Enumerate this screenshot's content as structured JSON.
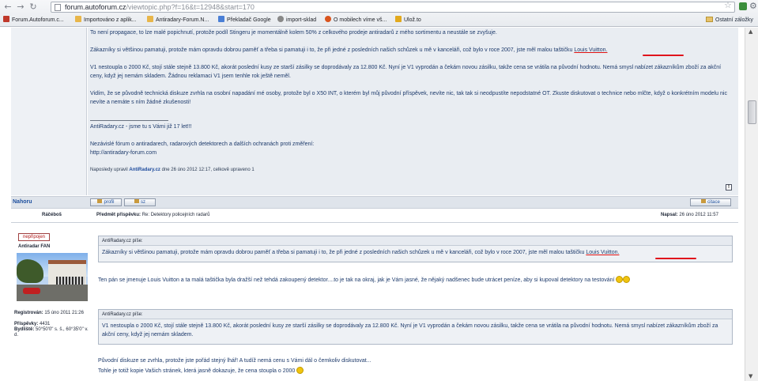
{
  "browser": {
    "url_host": "forum.autoforum.cz",
    "url_path": "/viewtopic.php?f=16&t=12948&start=170",
    "bookmarks": [
      {
        "label": "Forum.Autoforum.c...",
        "color": "#c0392b"
      },
      {
        "label": "Importováno z aplik...",
        "color": "#e8b64a"
      },
      {
        "label": "Antiradary-Forum.N...",
        "color": "#e8b64a"
      },
      {
        "label": "Překladač Google",
        "color": "#4a7fd6"
      },
      {
        "label": "import-sklad",
        "color": "#888888"
      },
      {
        "label": "O mobilech víme vš...",
        "color": "#d9541e"
      },
      {
        "label": "Ulož.to",
        "color": "#e2a91d"
      }
    ],
    "other_bookmarks": "Ostatní záložky"
  },
  "post1": {
    "para1": "To není propagace, to lze malé popichnutí, protože podíl Stingeru je momentálně kolem 50% z celkového prodeje antiradarů z mého sortimentu a neustále se zvyšuje.",
    "para2_a": "Zákazníky si většinou pamatuji, protože mám opravdu dobrou paměť a třeba si pamatuji i to, že při jedné z posledních našich schůzek u mě v kanceláři, což bylo v roce 2007, jste měl malou taštičku ",
    "para2_link": "Louis Vuitton.",
    "para3": "V1 nestoupla o 2000 Kč, stojí stále stejně 13.800 Kč, akorát poslední kusy ze starší zásilky se doprodávaly za 12.800 Kč. Nyní je V1 vyprodán a čekám novou zásilku, takže cena se vrátila na původní hodnotu. Nemá smysl nabízet zákazníkům zboží za akční ceny, když jej nemám skladem. Žádnou reklamaci V1 jsem tenhle rok ještě neměl.",
    "para4": "Vidím, že se původně technická diskuze zvrhla na osobní napadání mé osoby, protože byl o X50 INT, o kterém byl můj původní příspěvek, nevíte nic, tak tak si neodpustíte nepodstatné OT. Zkuste diskutovat o technice nebo mlčte, když o konkrétním modelu nic nevíte a nemáte s ním žádné zkušenosti!",
    "signature": "AntiRadary.cz - jsme tu s Vámi již 17 let!!!",
    "sig_line2": "Nezávislé fórum o antiradarech, radarových detektorech a dalších ochranách proti změření:",
    "sig_line3": "http://antiradary-forum.com",
    "edited_prefix": "Naposledy upravil ",
    "edited_user": "AntiRadary.cz",
    "edited_suffix": " dne 26 úno 2012 12:17, celkově upraveno 1"
  },
  "actionbar": {
    "top_link": "Nahoru",
    "profile_btn": "profil",
    "pm_btn": "sz",
    "quote_btn": "citace"
  },
  "post2": {
    "author": "Ráčéboš",
    "subject_label": "Předmět příspěvku:",
    "subject": " Re: Detektory policejních radarů",
    "posted_label": "Napsal:",
    "posted": " 26 úno 2012 11:57",
    "status_badge": "nepřipojen",
    "rank": "Antiradar FAN",
    "registered_label": "Registrován:",
    "registered": " 15 úno 2011 21:26",
    "posts_label": "Příspěvky:",
    "posts": " 4431",
    "location_label": "Bydliště:",
    "location": " 50°50'0\" s. š., 60°35'0\" v. d.",
    "quote1_header": "AntiRadary.cz píše:",
    "quote1_a": "Zákazníky si většinou pamatuji, protože mám opravdu dobrou paměť a třeba si pamatuji i to, že při jedné z posledních našich schůzek u mě v kanceláři, což bylo v roce 2007, jste měl malou taštičku ",
    "quote1_link": "Louis Vuitton.",
    "reply1": "Ten pán se jmenuje Louis Vuitton a ta malá taštička byla dražší než tehdá zakoupený detektor....to je tak na okraj, jak je Vám jasné, že nějaký nadšenec bude utrácet peníze, aby si kupoval detektory na testování",
    "quote2_header": "AntiRadary.cz píše:",
    "quote2": "V1 nestoupla o 2000 Kč, stojí stále stejně 13.800 Kč, akorát poslední kusy ze starší zásilky se doprodávaly za 12.800 Kč. Nyní je V1 vyprodán a čekám novou zásilku, takže cena se vrátila na původní hodnotu. Nemá smysl nabízet zákazníkům zboží za akční ceny, když jej nemám skladem.",
    "reply2_line1": "Původní diskuze se zvrhla, protože jste pořád stejný lhář! A tudíž nemá cenu s Vámi dál o čemkoliv diskutovat...",
    "reply2_line2": "Tohle je totiž kopie Vašich stránek, která jasně dokazuje, že cena stoupla o 2000"
  }
}
